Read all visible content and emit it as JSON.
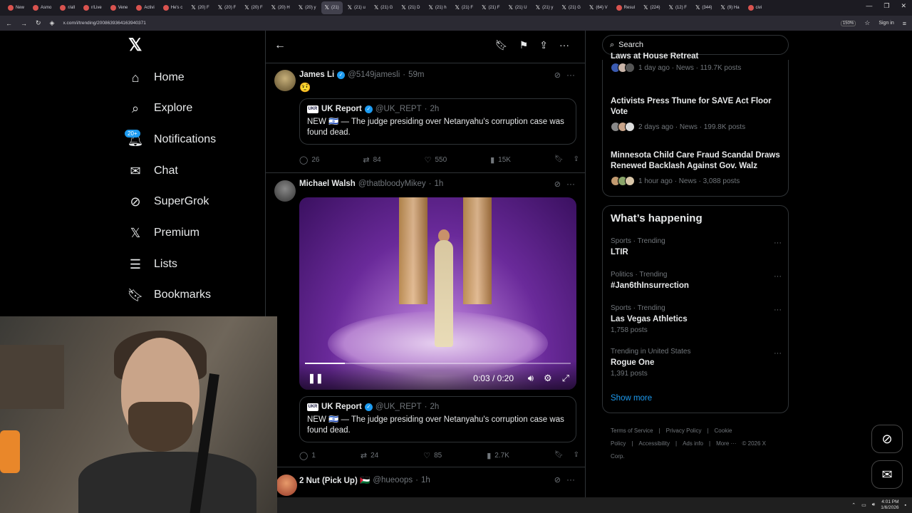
{
  "browser": {
    "tabs": [
      "New",
      "Asmo",
      "r/all",
      "r/Live",
      "Vene",
      "Activi",
      "He's c",
      "(20) F",
      "(20) F",
      "(20) F",
      "(20) H",
      "(20) y",
      "(21)",
      "(21) u",
      "(21) G",
      "(21) D",
      "(21) h",
      "(21) F",
      "(21) F",
      "(21) U",
      "(21) y",
      "(21) G",
      "(64) V",
      "Resul",
      "(224)",
      "(12) F",
      "(344)",
      "(9) Ha",
      "civi"
    ],
    "active_tab_index": 12,
    "url": "x.com/i/trending/2008639364163940371",
    "zoom": "150%",
    "sign_in": "Sign in"
  },
  "nav": {
    "items": [
      {
        "label": "Home",
        "icon": "home-icon"
      },
      {
        "label": "Explore",
        "icon": "search-icon"
      },
      {
        "label": "Notifications",
        "icon": "bell-icon"
      },
      {
        "label": "Chat",
        "icon": "mail-icon"
      },
      {
        "label": "SuperGrok",
        "icon": "grok-icon"
      },
      {
        "label": "Premium",
        "icon": "x-premium-icon"
      },
      {
        "label": "Lists",
        "icon": "list-icon"
      },
      {
        "label": "Bookmarks",
        "icon": "bookmark-icon"
      }
    ],
    "notif_badge": "20+"
  },
  "posts": [
    {
      "name": "James Li",
      "handle": "@5149jamesli",
      "time": "59m",
      "text": "🤨",
      "quote": {
        "avatar_text": "UKR",
        "name": "UK Report",
        "handle": "@UK_REPT",
        "time": "2h",
        "text": "NEW 🇮🇱 — The judge presiding over Netanyahu's corruption case was found dead."
      },
      "replies": "26",
      "reposts": "84",
      "likes": "550",
      "views": "15K"
    },
    {
      "name": "Michael Walsh",
      "handle": "@thatbloodyMikey",
      "time": "1h",
      "video": {
        "time": "0:03 / 0:20",
        "progress": 0.15
      },
      "quote": {
        "avatar_text": "UKR",
        "name": "UK Report",
        "handle": "@UK_REPT",
        "time": "2h",
        "text": "NEW 🇮🇱 — The judge presiding over Netanyahu's corruption case was found dead."
      },
      "replies": "1",
      "reposts": "24",
      "likes": "85",
      "views": "2.7K"
    },
    {
      "name": "2 Nut (Pick Up) 🇵🇸",
      "handle": "@hueoops",
      "time": "1h"
    }
  ],
  "search": {
    "placeholder": "Search"
  },
  "news": [
    {
      "title": "Laws at House Retreat",
      "meta": "1 day ago · News · 119.7K posts"
    },
    {
      "title": "Activists Press Thune for SAVE Act Floor Vote",
      "meta": "2 days ago · News · 199.8K posts"
    },
    {
      "title": "Minnesota Child Care Fraud Scandal Draws Renewed Backlash Against Gov. Walz",
      "meta": "1 hour ago · News · 3,088 posts"
    }
  ],
  "whats_happening": {
    "title": "What’s happening",
    "trends": [
      {
        "category": "Sports · Trending",
        "name": "LTIR",
        "posts": ""
      },
      {
        "category": "Politics · Trending",
        "name": "#Jan6thInsurrection",
        "posts": ""
      },
      {
        "category": "Sports · Trending",
        "name": "Las Vegas Athletics",
        "posts": "1,758 posts"
      },
      {
        "category": "Trending in United States",
        "name": "Rogue One",
        "posts": "1,391 posts"
      }
    ],
    "show_more": "Show more"
  },
  "footer": {
    "links": [
      "Terms of Service",
      "|",
      "Privacy Policy",
      "|",
      "Cookie Policy",
      "|",
      "Accessibility",
      "|",
      "Ads info",
      "|",
      "More ···",
      "© 2026 X Corp."
    ]
  },
  "taskbar": {
    "time": "4:01 PM",
    "date": "1/6/2026"
  },
  "colors": {
    "accent": "#1d9bf0",
    "background": "#000000",
    "muted": "#71767b"
  }
}
